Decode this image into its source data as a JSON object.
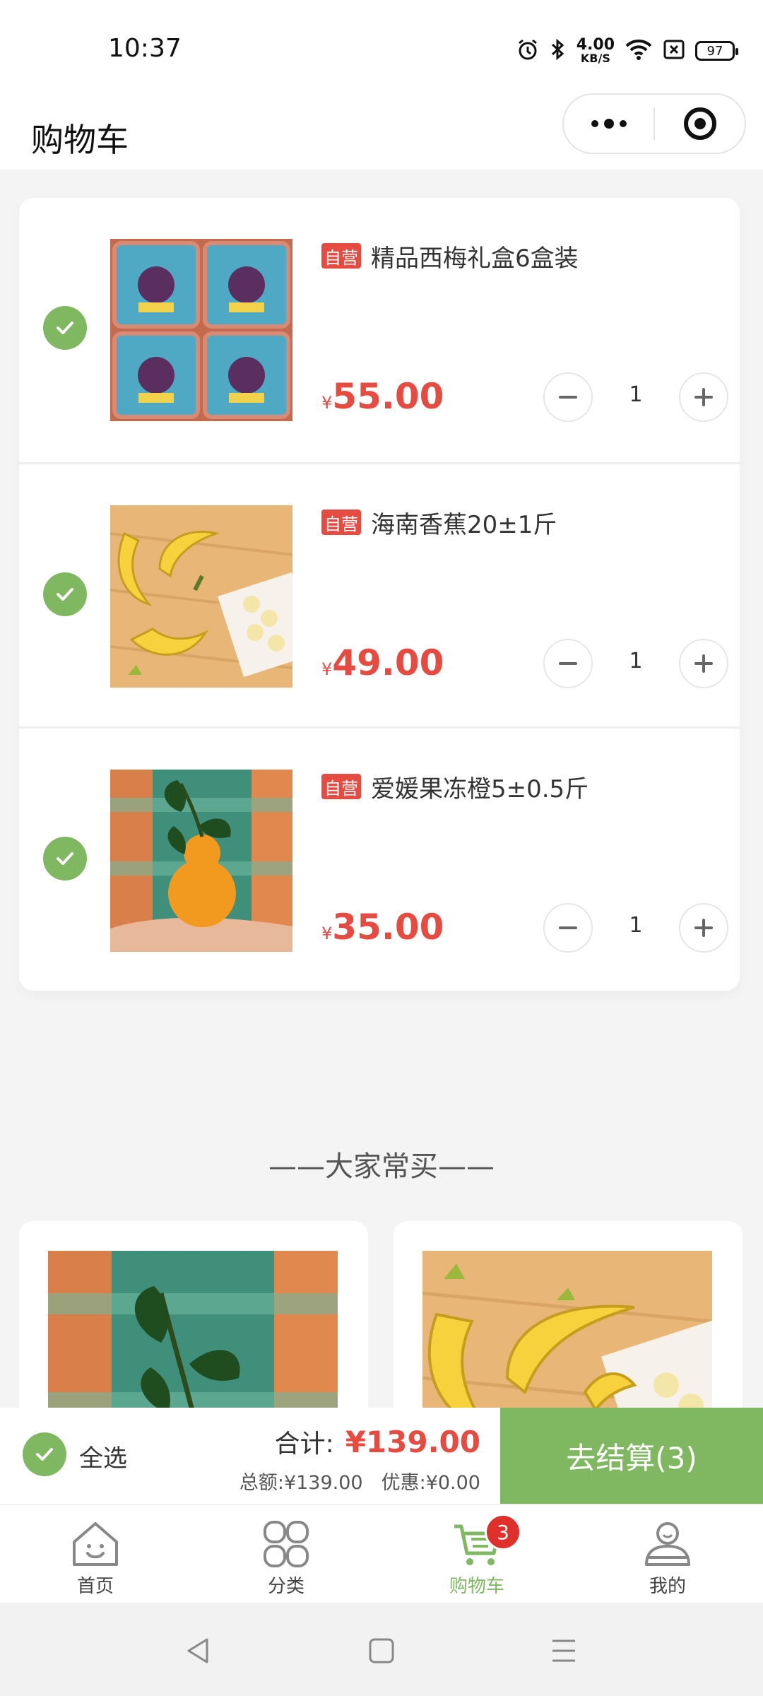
{
  "status_bar": {
    "time": "10:37",
    "network_speed_value": "4.00",
    "network_speed_unit": "KB/S",
    "battery": "97",
    "icons": [
      "alarm-icon",
      "bluetooth-icon",
      "wifi-icon",
      "sim-off-icon",
      "battery-icon"
    ]
  },
  "header": {
    "title": "购物车",
    "capsule_icons": [
      "more-dots-icon",
      "target-icon"
    ]
  },
  "cart": {
    "items": [
      {
        "tag": "自营",
        "name": "精品西梅礼盒6盒装",
        "currency": "¥",
        "price": "55.00",
        "quantity": "1",
        "checked": true,
        "image": "prune-gift-box"
      },
      {
        "tag": "自营",
        "name": "海南香蕉20±1斤",
        "currency": "¥",
        "price": "49.00",
        "quantity": "1",
        "checked": true,
        "image": "bananas"
      },
      {
        "tag": "自营",
        "name": "爱媛果冻橙5±0.5斤",
        "currency": "¥",
        "price": "35.00",
        "quantity": "1",
        "checked": true,
        "image": "orange-in-hand"
      }
    ]
  },
  "recommendations": {
    "title": "——大家常买——",
    "items": [
      {
        "image": "orange-in-hand"
      },
      {
        "image": "bananas"
      }
    ]
  },
  "checkout": {
    "select_all_label": "全选",
    "total_label": "合计:",
    "total_amount": "¥139.00",
    "subtotal_text": "总额:¥139.00",
    "discount_text": "优惠:¥0.00",
    "checkout_button": "去结算(3)"
  },
  "tab_bar": {
    "tabs": [
      {
        "label": "首页",
        "icon": "home-icon",
        "active": false
      },
      {
        "label": "分类",
        "icon": "category-icon",
        "active": false
      },
      {
        "label": "购物车",
        "icon": "cart-icon",
        "active": true,
        "badge": "3"
      },
      {
        "label": "我的",
        "icon": "profile-icon",
        "active": false
      }
    ]
  },
  "colors": {
    "accent_green": "#7fb860",
    "price_red": "#e54b40",
    "badge_red": "#e0302b",
    "background": "#f4f4f4"
  }
}
